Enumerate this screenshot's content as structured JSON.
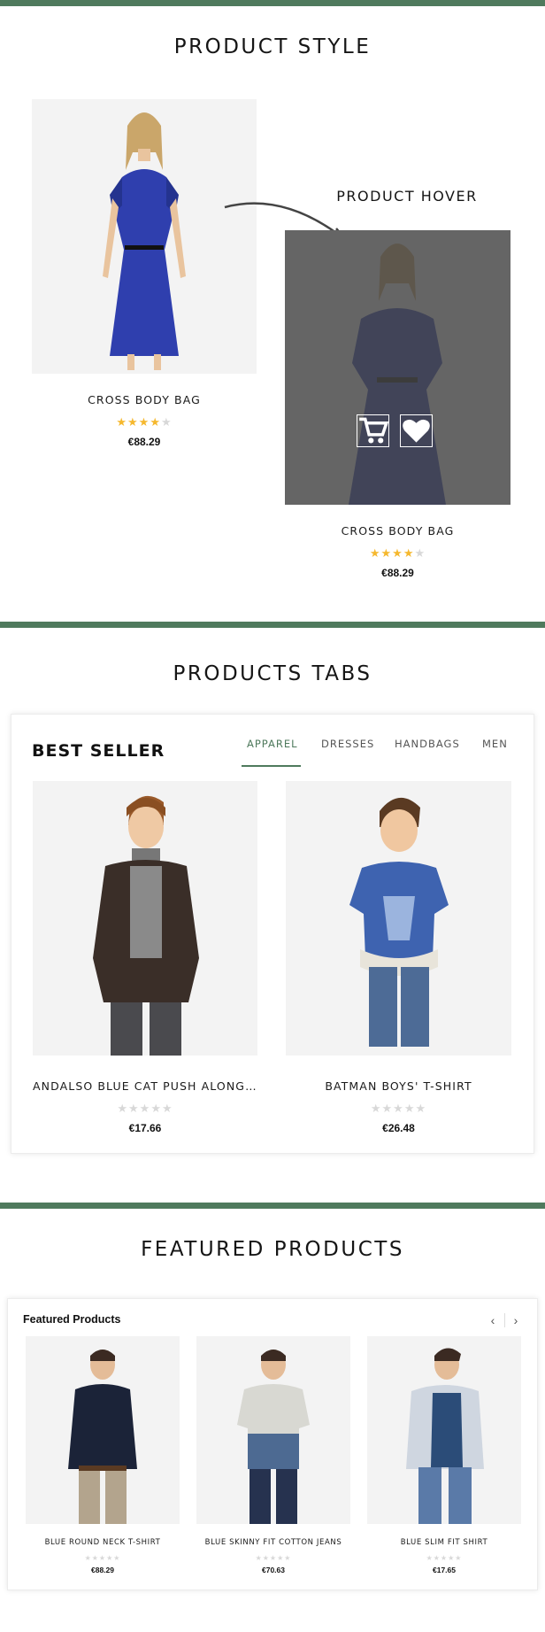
{
  "sections": {
    "product_style": "PRODUCT STYLE",
    "products_tabs": "PRODUCTS TABS",
    "featured_products": "FEATURED PRODUCTS"
  },
  "product_style": {
    "hover_label": "PRODUCT HOVER",
    "normal": {
      "name": "CROSS BODY BAG",
      "price": "€88.29",
      "rating": 4
    },
    "hovered": {
      "name": "CROSS BODY BAG",
      "price": "€88.29",
      "rating": 4
    }
  },
  "tabs_card": {
    "heading": "BEST SELLER",
    "tabs": [
      "APPAREL",
      "DRESSES",
      "HANDBAGS",
      "MEN"
    ],
    "active_tab": "APPAREL",
    "products": [
      {
        "name": "ANDALSO BLUE CAT PUSH ALONG C...",
        "price": "€17.66",
        "rating": 0
      },
      {
        "name": "BATMAN BOYS' T-SHIRT",
        "price": "€26.48",
        "rating": 0
      }
    ]
  },
  "featured_card": {
    "heading": "Featured Products",
    "prev_icon": "chevron-left-icon",
    "next_icon": "chevron-right-icon",
    "products": [
      {
        "name": "BLUE ROUND NECK T-SHIRT",
        "price": "€88.29",
        "rating": 0
      },
      {
        "name": "BLUE SKINNY FIT COTTON JEANS",
        "price": "€70.63",
        "rating": 0
      },
      {
        "name": "BLUE SLIM FIT SHIRT",
        "price": "€17.65",
        "rating": 0
      }
    ]
  },
  "colors": {
    "accent": "#4f7a5d",
    "star": "#f5b82e",
    "star_empty": "#d8d8d8"
  }
}
